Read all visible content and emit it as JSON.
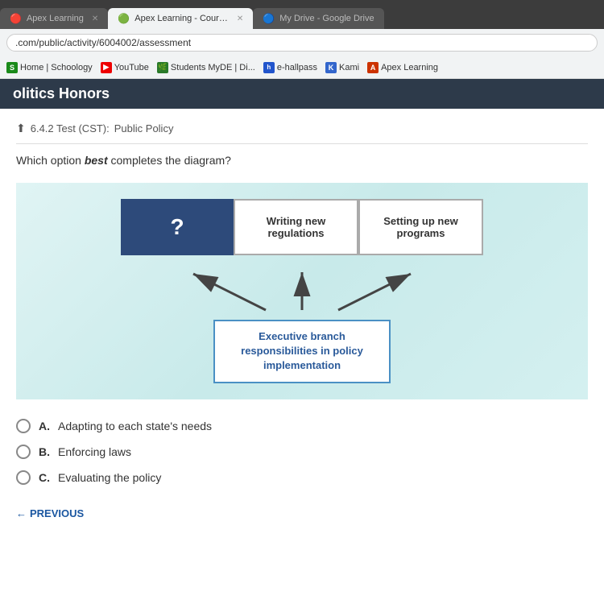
{
  "browser": {
    "tabs": [
      {
        "label": "Apex Learning",
        "active": false,
        "favicon": "🔴"
      },
      {
        "label": "Apex Learning - Courses",
        "active": true,
        "favicon": "🟢"
      },
      {
        "label": "My Drive - Google Drive",
        "active": false,
        "favicon": "🔵"
      }
    ],
    "address": ".com/public/activity/6004002/assessment",
    "bookmarks": [
      {
        "label": "Home | Schoology",
        "color": "#1a8a1a",
        "text_color": "#fff",
        "icon": "S"
      },
      {
        "label": "YouTube",
        "color": "#e00",
        "text_color": "#fff",
        "icon": "▶"
      },
      {
        "label": "Students MyDE | Di...",
        "color": "#2a7a2a",
        "text_color": "#fff",
        "icon": "🌿"
      },
      {
        "label": "e-hallpass",
        "color": "#2255cc",
        "text_color": "#fff",
        "icon": "h"
      },
      {
        "label": "Kami",
        "color": "#3366cc",
        "text_color": "#fff",
        "icon": "K"
      },
      {
        "label": "Apex Learning",
        "color": "#cc3300",
        "text_color": "#fff",
        "icon": "A"
      }
    ]
  },
  "page": {
    "header": "olitics Honors",
    "breadcrumb_icon": "⬆",
    "breadcrumb_label": "6.4.2 Test (CST):",
    "breadcrumb_sub": "Public Policy",
    "question": "Which option best completes the diagram?",
    "question_em": "best"
  },
  "diagram": {
    "unknown_symbol": "?",
    "box1_text": "Writing new regulations",
    "box2_text": "Setting up new programs",
    "bottom_text": "Executive branch responsibilities in policy implementation"
  },
  "answers": [
    {
      "key": "A",
      "text": "Adapting to each state's needs"
    },
    {
      "key": "B",
      "text": "Enforcing laws"
    },
    {
      "key": "C",
      "text": "Evaluating the policy"
    }
  ],
  "nav": {
    "previous_label": "PREVIOUS",
    "previous_arrow": "←"
  }
}
